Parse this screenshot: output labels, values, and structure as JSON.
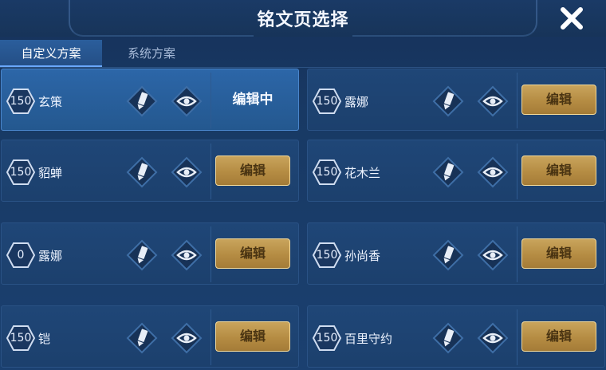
{
  "header": {
    "title": "铭文页选择"
  },
  "tabs": [
    {
      "label": "自定义方案",
      "active": true
    },
    {
      "label": "系统方案",
      "active": false
    }
  ],
  "cards": [
    {
      "level": "150",
      "name": "玄策",
      "status": "编辑中",
      "selected": true
    },
    {
      "level": "150",
      "name": "露娜",
      "action": "编辑"
    },
    {
      "level": "150",
      "name": "貂蝉",
      "action": "编辑"
    },
    {
      "level": "150",
      "name": "花木兰",
      "action": "编辑"
    },
    {
      "level": "0",
      "name": "露娜",
      "action": "编辑"
    },
    {
      "level": "150",
      "name": "孙尚香",
      "action": "编辑"
    },
    {
      "level": "150",
      "name": "铠",
      "action": "编辑"
    },
    {
      "level": "150",
      "name": "百里守约",
      "action": "编辑"
    }
  ],
  "colors": {
    "accent_gold": "#b58c43",
    "panel": "#1f4677",
    "selected": "#2c66a8"
  },
  "icons": {
    "close": "close-icon",
    "rename": "pencil-icon",
    "preview": "eye-icon",
    "level": "hexagon-level-badge"
  }
}
